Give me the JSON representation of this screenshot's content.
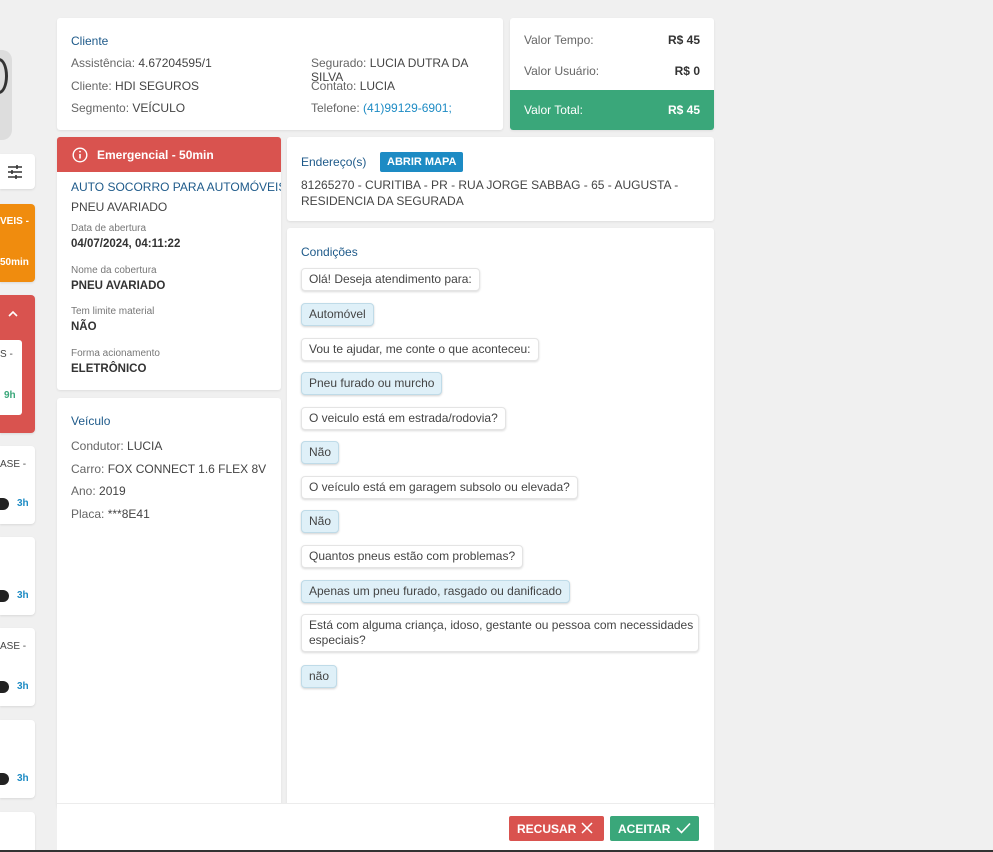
{
  "left_list": {
    "card2_text1": "VEIS -",
    "card2_text2": "50min",
    "card3_text1": "S -",
    "card3_time": "9h",
    "card4_text": "ASE -",
    "card4_time": "3h",
    "card5_time": "3h",
    "card6_text": "ASE -",
    "card6_time": "3h",
    "card7_time": "3h"
  },
  "client": {
    "title": "Cliente",
    "assistencia_label": "Assistência:",
    "assistencia_value": "4.67204595/1",
    "cliente_label": "Cliente:",
    "cliente_value": "HDI SEGUROS",
    "segmento_label": "Segmento:",
    "segmento_value": "VEÍCULO",
    "segurado_label": "Segurado:",
    "segurado_value": "LUCIA DUTRA DA SILVA",
    "contato_label": "Contato:",
    "contato_value": "LUCIA",
    "telefone_label": "Telefone:",
    "telefone_value": "(41)99129-6901;"
  },
  "values": {
    "tempo_label": "Valor Tempo:",
    "tempo_value": "R$ 45",
    "usuario_label": "Valor Usuário:",
    "usuario_value": "R$ 0",
    "total_label": "Valor Total:",
    "total_value": "R$ 45"
  },
  "service": {
    "banner": "Emergencial - 50min",
    "title": "AUTO SOCORRO PARA AUTOMÓVEIS",
    "subtitle": "PNEU AVARIADO",
    "abertura_label": "Data de abertura",
    "abertura_value": "04/07/2024, 04:11:22",
    "cobertura_label": "Nome da cobertura",
    "cobertura_value": "PNEU AVARIADO",
    "limite_label": "Tem limite material",
    "limite_value": "NÃO",
    "acionamento_label": "Forma acionamento",
    "acionamento_value": "ELETRÔNICO"
  },
  "vehicle": {
    "title": "Veículo",
    "condutor_label": "Condutor:",
    "condutor_value": "LUCIA",
    "carro_label": "Carro:",
    "carro_value": "FOX CONNECT 1.6 FLEX 8V",
    "ano_label": "Ano:",
    "ano_value": "2019",
    "placa_label": "Placa:",
    "placa_value": "***8E41"
  },
  "address": {
    "title": "Endereço(s)",
    "map_button": "ABRIR MAPA",
    "line1": "81265270 - CURITIBA - PR - RUA JORGE SABBAG - 65 - AUGUSTA -",
    "line2": "RESIDENCIA DA SEGURADA"
  },
  "conditions": {
    "title": "Condições",
    "q1": "Olá! Deseja atendimento para:",
    "a1": "Automóvel",
    "q2": "Vou te ajudar, me conte o que aconteceu:",
    "a2": "Pneu furado ou murcho",
    "q3": "O veiculo está em estrada/rodovia?",
    "a3": "Não",
    "q4": "O veículo está em garagem subsolo ou elevada?",
    "a4": "Não",
    "q5": "Quantos pneus estão com problemas?",
    "a5": "Apenas um pneu furado, rasgado ou danificado",
    "q6_line1": "Está com alguma criança, idoso, gestante ou pessoa com necessidades",
    "q6_line2": "especiais?",
    "a6": "não"
  },
  "actions": {
    "recusar": "RECUSAR",
    "aceitar": "ACEITAR"
  },
  "colors": {
    "danger": "#d9534f",
    "success": "#3aa77a",
    "primary": "#1d8bc4",
    "warning": "#f08c0e"
  }
}
